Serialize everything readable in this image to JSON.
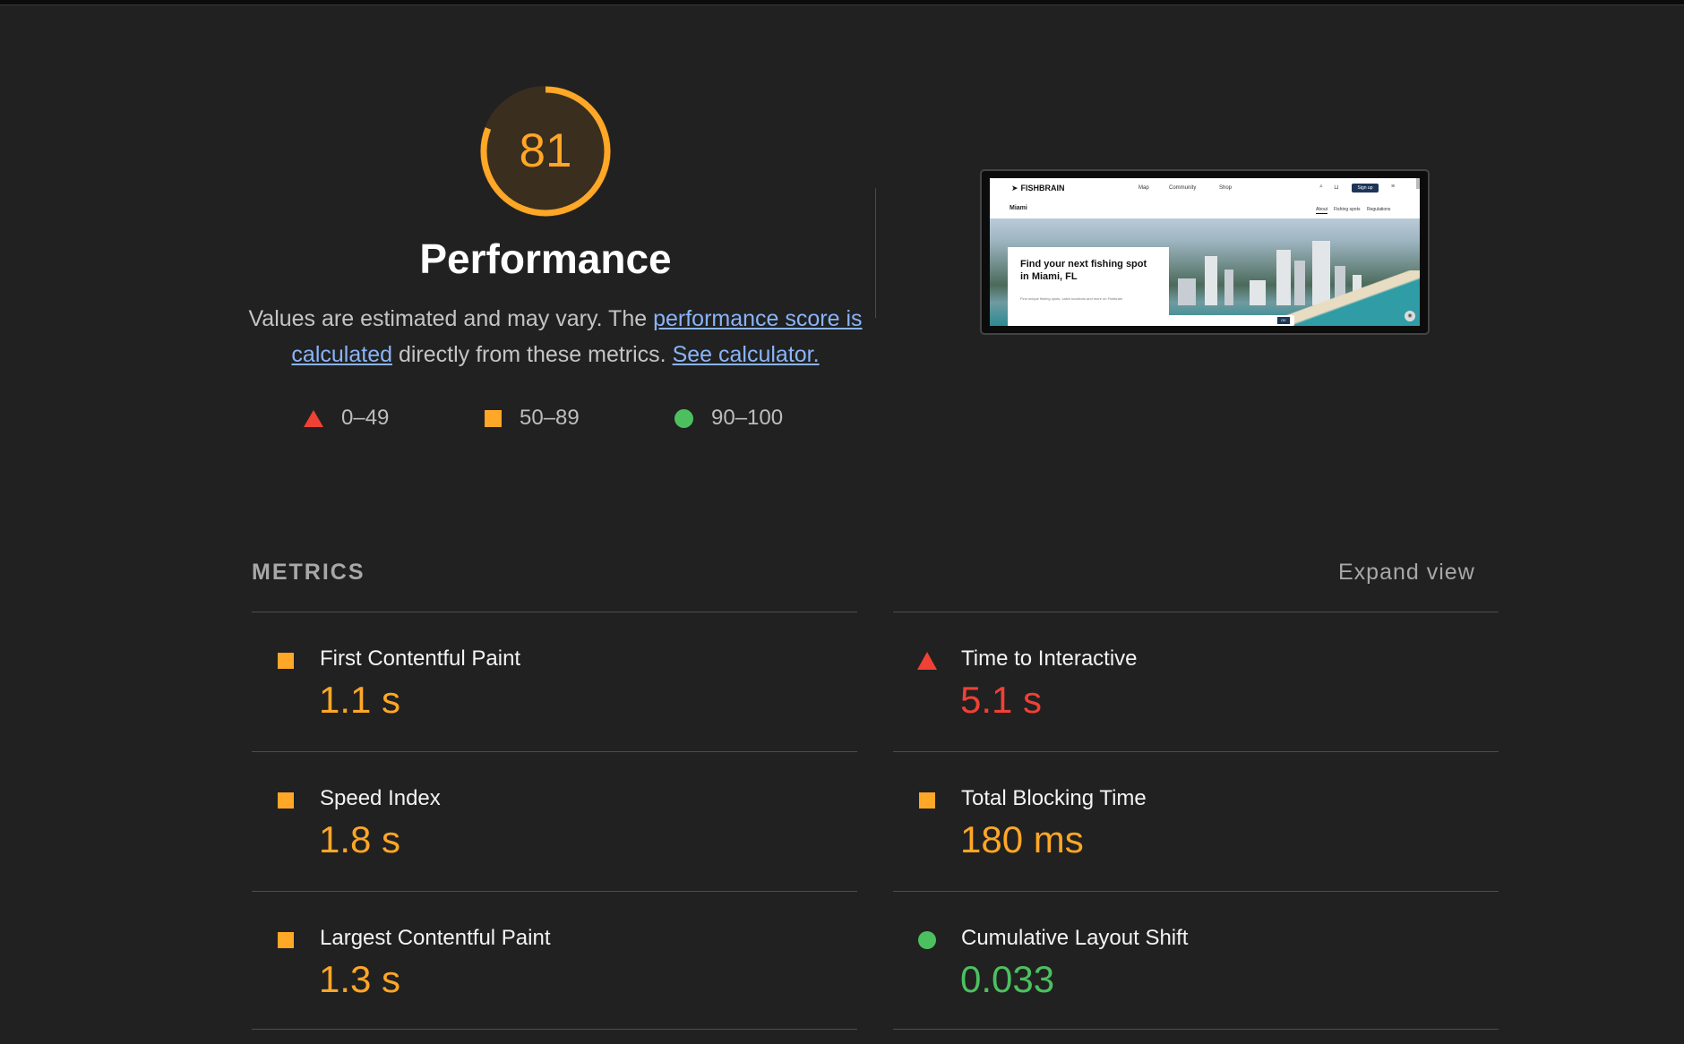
{
  "score": {
    "value": "81",
    "percent": 81,
    "color": "#ffa726",
    "title": "Performance",
    "description_pre": "Values are estimated and may vary. The ",
    "link_score": "performance score is calculated",
    "description_mid": " directly from these metrics. ",
    "link_calculator": "See calculator."
  },
  "legend": [
    {
      "icon": "triangle-fail-icon",
      "label": "0–49",
      "color": "#ef4136"
    },
    {
      "icon": "square-average-icon",
      "label": "50–89",
      "color": "#ffa726"
    },
    {
      "icon": "circle-pass-icon",
      "label": "90–100",
      "color": "#4cc05f"
    }
  ],
  "screenshot": {
    "logo": "FISHBRAIN",
    "nav": [
      "Map",
      "Community",
      "Shop"
    ],
    "signup": "Sign up",
    "city": "Miami",
    "tabs": [
      "About",
      "Fishing spots",
      "Regulations"
    ],
    "card_title": "Find your next fishing spot in Miami, FL",
    "card_text": "Find unique fishing spots, catch locations and more on Fishbrain",
    "cookie_ok": "OK"
  },
  "metrics": {
    "title": "METRICS",
    "expand": "Expand view",
    "items": [
      {
        "label": "First Contentful Paint",
        "value": "1.1 s",
        "status": "average"
      },
      {
        "label": "Time to Interactive",
        "value": "5.1 s",
        "status": "fail"
      },
      {
        "label": "Speed Index",
        "value": "1.8 s",
        "status": "average"
      },
      {
        "label": "Total Blocking Time",
        "value": "180 ms",
        "status": "average"
      },
      {
        "label": "Largest Contentful Paint",
        "value": "1.3 s",
        "status": "average"
      },
      {
        "label": "Cumulative Layout Shift",
        "value": "0.033",
        "status": "pass"
      }
    ]
  }
}
